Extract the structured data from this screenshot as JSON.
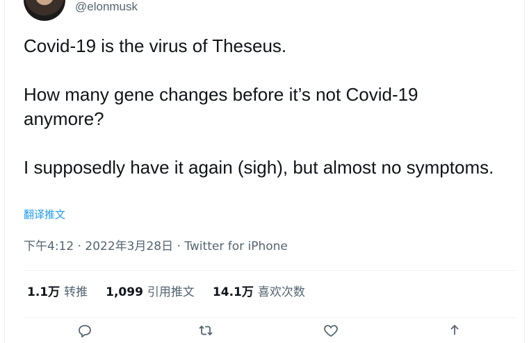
{
  "author": {
    "handle": "@elonmusk"
  },
  "tweet": {
    "paragraphs": [
      "Covid-19 is the virus of Theseus.",
      "How many gene changes before it’s not Covid-19 anymore?",
      "I supposedly have it again (sigh), but almost no symptoms."
    ],
    "translate_label": "翻译推文",
    "timestamp": "下午4:12 · 2022年3月28日",
    "separator": " · ",
    "source": "Twitter for iPhone"
  },
  "stats": {
    "retweets_count": "1.1万",
    "retweets_label": "转推",
    "quotes_count": "1,099",
    "quotes_label": "引用推文",
    "likes_count": "14.1万",
    "likes_label": "喜欢次数"
  },
  "actions": {
    "icons": [
      "reply-icon",
      "retweet-icon",
      "like-icon",
      "share-icon"
    ]
  },
  "colors": {
    "link": "#1d9bf0",
    "secondary_text": "#536471",
    "primary_text": "#0f1419",
    "divider": "#eff3f4"
  }
}
